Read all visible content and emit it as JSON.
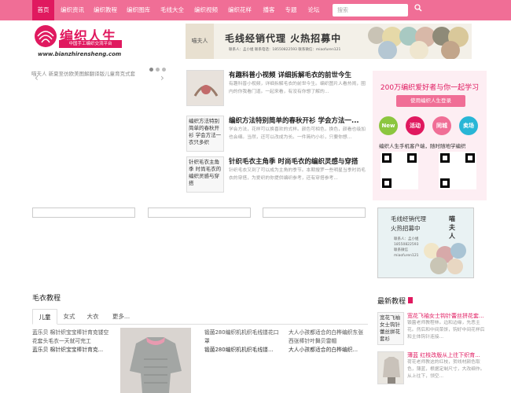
{
  "nav": {
    "items": [
      "首页",
      "编织资讯",
      "编织教程",
      "编织图库",
      "毛线大全",
      "编织视频",
      "编织花样",
      "播客",
      "专题",
      "论坛"
    ],
    "search_placeholder": "搜索"
  },
  "logo": {
    "title": "编织人生",
    "subtitle": "中国手工编织交流平台",
    "url": "www.bianzhirensheng.com"
  },
  "banner": {
    "brand": "喵夫人",
    "headline": "毛线经销代理   火热招募中",
    "contact": "联系人：孟小姐  联系电话：18550822593  联系微信：miaofuren121"
  },
  "slider": {
    "caption": "喵夫人 新夏至仿欧美图解翻译版儿童育克式套"
  },
  "news": [
    {
      "title": "有趣科普小视频 详细拆解毛衣的前世今生",
      "desc": "有趣科普小视频，详细拆解毛衣的前世今生。编织图片人看热闹，圈内的你我看门道。一起来看，有没有你想了解的..."
    },
    {
      "title": "编织方法特别简单的春秋开衫 学会方法一...",
      "thumb": "编织方法特别简单的春秋开衫 学会方法一衣只多织",
      "desc": "学会方法，花样可以换喜欢的式样。颜色可相色，换色，颜看也级加也会细。当然，还可以改成为长。一件简约小衫，只要你想..."
    },
    {
      "title": "针织毛衣主角季 时尚毛衣的编织灵感与穿搭",
      "thumb": "针织毛衣主角季 时尚毛衣的编织灵感与穿搭",
      "desc": "针织毛衣又到了可以成为主角的季节。本期搜罗一些明星当季时尚毛衣的穿搭，为爱织的你提供编织参考，还有穿搭参考..."
    }
  ],
  "panel": {
    "title": "200万编织爱好者与你一起学习",
    "login_label": "使用编织人生登录",
    "circles": [
      {
        "label": "New",
        "color": "#8cc63f"
      },
      {
        "label": "活动",
        "color": "#e0195f"
      },
      {
        "label": "同城",
        "color": "#f06e96"
      },
      {
        "label": "卖场",
        "color": "#29b6d6"
      }
    ],
    "caption": "编织人生手机客户端，随时随地学编织"
  },
  "ad2": {
    "line1": "毛线经销代理\n火热招募中",
    "brand": "喵\n夫\n人",
    "contact": "联系人：孟小姐\n18550822593\n联系微信\nmiaofuren121"
  },
  "tutorials": {
    "title": "毛衣教程",
    "tabs": [
      "儿童",
      "女式",
      "大衣",
      "更多..."
    ],
    "products": [
      {
        "img_alt": "蓝乐贝 棉针织宝宝棒针育克镂空花套头毛衣一天就可完工",
        "title": "蓝乐贝 棉针织宝宝棒针育克..."
      },
      {
        "img_alt": "锻菌280编织机机织毛线镂花口罩",
        "title": "锻菌280编织机机织毛线镂..."
      },
      {
        "img_alt": "大人小孩都适合的白桦编织东张西张棒针叶舞贝雷帽",
        "title": "大人小孩都适合的白桦编织..."
      }
    ]
  },
  "latest": {
    "title": "最新教程",
    "items": [
      {
        "thumb": "宽花飞袖女士钩针蕾丝拼花套衫",
        "title": "宽花飞袖女士钩针蕾丝拼花套...",
        "desc": "锻菌老师教程林。边和边缘，先恶主花。然后和中间菜饼，钩好中间花样后和主体钩针连接..."
      },
      {
        "thumb": "",
        "title": "薄蓝 红枝改版从上往下织育...",
        "desc": "荷花老师教这的红枝，贺线材颜色取色，薄蓝，根据定制尺寸，大改细作。从上往下，领空..."
      }
    ]
  }
}
